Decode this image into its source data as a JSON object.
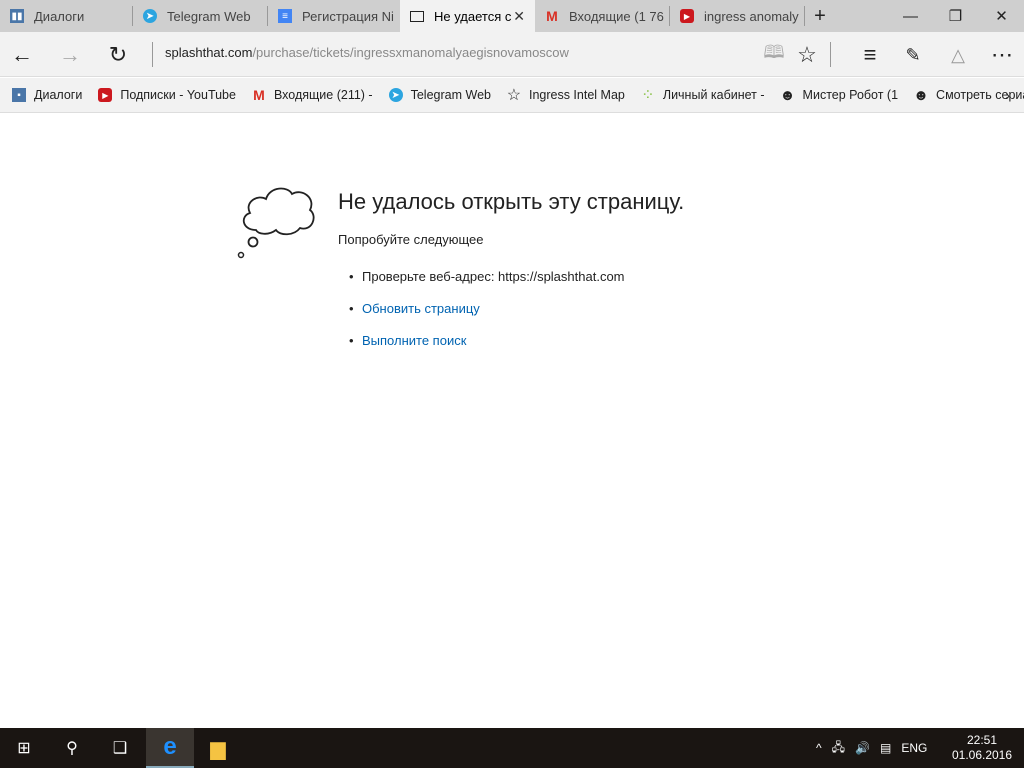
{
  "tabs": [
    {
      "label": "Диалоги",
      "icon": "vk-icon",
      "color": "#4a76a8"
    },
    {
      "label": "Telegram Web",
      "icon": "telegram-icon",
      "color": "#2ca5e0"
    },
    {
      "label": "Регистрация Ni",
      "icon": "docs-icon",
      "color": "#4285f4"
    },
    {
      "label": "Не удается с",
      "icon": "page-icon",
      "color": "#222"
    },
    {
      "label": "Входящие (1 76",
      "icon": "gmail-icon",
      "color": "#d93025"
    },
    {
      "label": "ingress anomaly",
      "icon": "youtube-icon",
      "color": "#cc181e"
    }
  ],
  "address": {
    "domain": "splashthat.com",
    "path": "/purchase/tickets/ingressxmanomalyaegisnovamoscow"
  },
  "bookmarks": [
    {
      "label": "Диалоги",
      "icon": "vk-icon"
    },
    {
      "label": "Подписки - YouTube",
      "icon": "youtube-icon"
    },
    {
      "label": "Входящие (211) -",
      "icon": "gmail-icon"
    },
    {
      "label": "Telegram Web",
      "icon": "telegram-icon"
    },
    {
      "label": "Ingress Intel Map",
      "icon": "star-icon"
    },
    {
      "label": "Личный кабинет -",
      "icon": "dots-icon"
    },
    {
      "label": "Мистер Робот (1",
      "icon": "face-icon"
    },
    {
      "label": "Смотреть сериал",
      "icon": "face-icon"
    }
  ],
  "error": {
    "title": "Не удалось открыть эту страницу.",
    "subtitle": "Попробуйте следующее",
    "items": [
      "Проверьте веб-адрес: https://splashthat.com",
      "Обновить страницу",
      "Выполните поиск"
    ]
  },
  "tray": {
    "lang": "ENG",
    "time": "22:51",
    "date": "01.06.2016"
  }
}
